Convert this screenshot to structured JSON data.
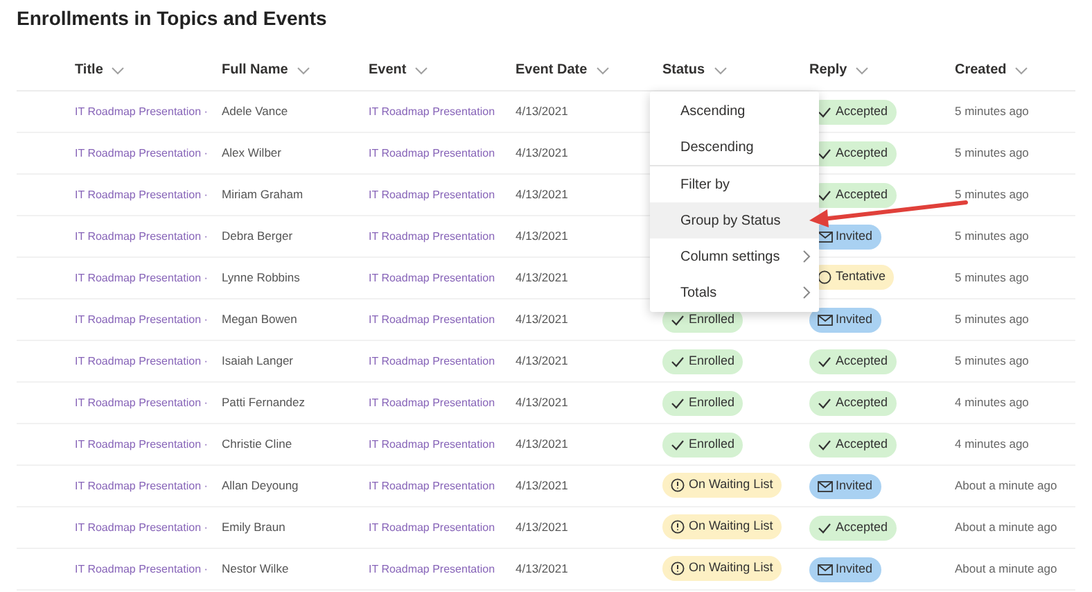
{
  "title": "Enrollments in Topics and Events",
  "columns": [
    "Title",
    "Full Name",
    "Event",
    "Event Date",
    "Status",
    "Reply",
    "Created"
  ],
  "rows": [
    {
      "title": "IT Roadmap Presentation ·",
      "full_name": "Adele Vance",
      "event": "IT Roadmap Presentation",
      "date": "4/13/2021",
      "reply": {
        "kind": "accepted",
        "label": "Accepted"
      },
      "created": "5 minutes ago"
    },
    {
      "title": "IT Roadmap Presentation ·",
      "full_name": "Alex Wilber",
      "event": "IT Roadmap Presentation",
      "date": "4/13/2021",
      "reply": {
        "kind": "accepted",
        "label": "Accepted"
      },
      "created": "5 minutes ago"
    },
    {
      "title": "IT Roadmap Presentation ·",
      "full_name": "Miriam Graham",
      "event": "IT Roadmap Presentation",
      "date": "4/13/2021",
      "reply": {
        "kind": "accepted",
        "label": "Accepted"
      },
      "created": "5 minutes ago"
    },
    {
      "title": "IT Roadmap Presentation ·",
      "full_name": "Debra Berger",
      "event": "IT Roadmap Presentation",
      "date": "4/13/2021",
      "reply": {
        "kind": "invited",
        "label": "Invited"
      },
      "created": "5 minutes ago"
    },
    {
      "title": "IT Roadmap Presentation ·",
      "full_name": "Lynne Robbins",
      "event": "IT Roadmap Presentation",
      "date": "4/13/2021",
      "reply": {
        "kind": "tentative",
        "label": "Tentative"
      },
      "created": "5 minutes ago"
    },
    {
      "title": "IT Roadmap Presentation ·",
      "full_name": "Megan Bowen",
      "event": "IT Roadmap Presentation",
      "date": "4/13/2021",
      "status": {
        "kind": "enrolled",
        "label": "Enrolled"
      },
      "reply": {
        "kind": "invited",
        "label": "Invited"
      },
      "created": "5 minutes ago"
    },
    {
      "title": "IT Roadmap Presentation ·",
      "full_name": "Isaiah Langer",
      "event": "IT Roadmap Presentation",
      "date": "4/13/2021",
      "status": {
        "kind": "enrolled",
        "label": "Enrolled"
      },
      "reply": {
        "kind": "accepted",
        "label": "Accepted"
      },
      "created": "5 minutes ago"
    },
    {
      "title": "IT Roadmap Presentation ·",
      "full_name": "Patti Fernandez",
      "event": "IT Roadmap Presentation",
      "date": "4/13/2021",
      "status": {
        "kind": "enrolled",
        "label": "Enrolled"
      },
      "reply": {
        "kind": "accepted",
        "label": "Accepted"
      },
      "created": "4 minutes ago"
    },
    {
      "title": "IT Roadmap Presentation ·",
      "full_name": "Christie Cline",
      "event": "IT Roadmap Presentation",
      "date": "4/13/2021",
      "status": {
        "kind": "enrolled",
        "label": "Enrolled"
      },
      "reply": {
        "kind": "accepted",
        "label": "Accepted"
      },
      "created": "4 minutes ago"
    },
    {
      "title": "IT Roadmap Presentation ·",
      "full_name": "Allan Deyoung",
      "event": "IT Roadmap Presentation",
      "date": "4/13/2021",
      "status": {
        "kind": "waiting",
        "label": "On Waiting List"
      },
      "reply": {
        "kind": "invited",
        "label": "Invited"
      },
      "created": "About a minute ago"
    },
    {
      "title": "IT Roadmap Presentation ·",
      "full_name": "Emily Braun",
      "event": "IT Roadmap Presentation",
      "date": "4/13/2021",
      "status": {
        "kind": "waiting",
        "label": "On Waiting List"
      },
      "reply": {
        "kind": "accepted",
        "label": "Accepted"
      },
      "created": "About a minute ago"
    },
    {
      "title": "IT Roadmap Presentation ·",
      "full_name": "Nestor Wilke",
      "event": "IT Roadmap Presentation",
      "date": "4/13/2021",
      "status": {
        "kind": "waiting",
        "label": "On Waiting List"
      },
      "reply": {
        "kind": "invited",
        "label": "Invited"
      },
      "created": "About a minute ago"
    }
  ],
  "menu": {
    "sections": [
      [
        {
          "label": "Ascending",
          "selected": false,
          "submenu": false
        },
        {
          "label": "Descending",
          "selected": false,
          "submenu": false
        }
      ],
      [
        {
          "label": "Filter by",
          "selected": false,
          "submenu": false
        },
        {
          "label": "Group by Status",
          "selected": true,
          "submenu": false
        },
        {
          "label": "Column settings",
          "selected": false,
          "submenu": true
        },
        {
          "label": "Totals",
          "selected": false,
          "submenu": true
        }
      ]
    ]
  }
}
